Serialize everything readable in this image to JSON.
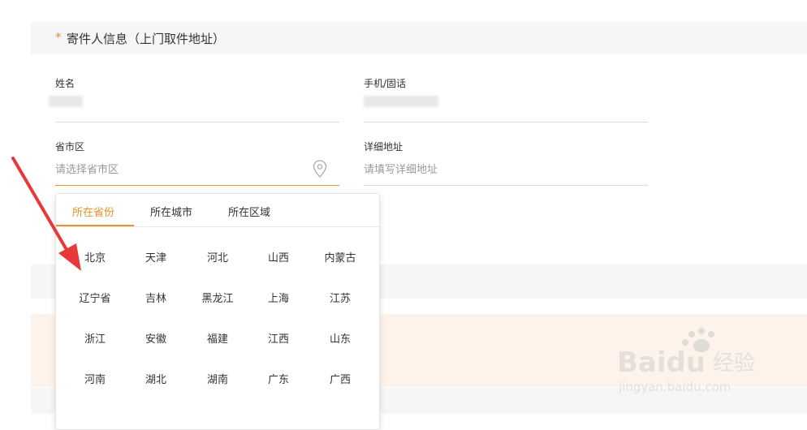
{
  "section": {
    "required_mark": "*",
    "title": "寄件人信息（上门取件地址）"
  },
  "fields": {
    "name_label": "姓名",
    "phone_label": "手机/固话",
    "region_label": "省市区",
    "region_placeholder": "请选择省市区",
    "address_label": "详细地址",
    "address_placeholder": "请填写详细地址"
  },
  "region_picker": {
    "tabs": [
      "所在省份",
      "所在城市",
      "所在区域"
    ],
    "active_tab": 0,
    "provinces": [
      [
        "北京",
        "天津",
        "河北",
        "山西",
        "内蒙古"
      ],
      [
        "辽宁省",
        "吉林",
        "黑龙江",
        "上海",
        "江苏"
      ],
      [
        "浙江",
        "安徽",
        "福建",
        "江西",
        "山东"
      ],
      [
        "河南",
        "湖北",
        "湖南",
        "广东",
        "广西"
      ]
    ]
  },
  "watermark": {
    "brand": "Baidu",
    "brand_cn": "经验",
    "url": "jingyan.baidu.com"
  },
  "colors": {
    "accent": "#e8912f",
    "arrow": "#e8383a",
    "header_bg": "#f6f6f8",
    "band_bg": "#fdf3ea"
  },
  "icons": {
    "location": "location-pin-icon"
  }
}
